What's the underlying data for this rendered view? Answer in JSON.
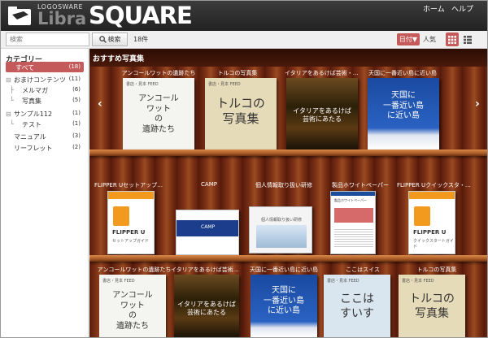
{
  "header": {
    "logo_small": "LOGOSWARE",
    "logo_libra": "Libra",
    "logo_square": "SQUARE",
    "nav": [
      "ホーム",
      "ヘルプ"
    ]
  },
  "search": {
    "placeholder": "検索",
    "button_label": "検索",
    "result_count": "18件"
  },
  "sort": {
    "selected": "日付▼",
    "alternate": "人気"
  },
  "sidebar": {
    "title": "カテゴリー",
    "items": [
      {
        "label": "すべて",
        "count": "(18)"
      },
      {
        "label": "おまけコンテンツ",
        "count": "(11)"
      },
      {
        "label": "メルマガ",
        "count": "(6)"
      },
      {
        "label": "写真集",
        "count": "(5)"
      },
      {
        "label": "サンプル112",
        "count": "(1)"
      },
      {
        "label": "テスト",
        "count": "(1)"
      },
      {
        "label": "マニュアル",
        "count": "(3)"
      },
      {
        "label": "リーフレット",
        "count": "(2)"
      }
    ]
  },
  "main": {
    "title": "おすすめ写真集",
    "shelf1": [
      {
        "title": "アンコールワットの遺跡たち",
        "cover_text": "アンコール\nワット\nの\n遺跡たち"
      },
      {
        "title": "トルコの写真集",
        "cover_text": "トルコの\n写真集"
      },
      {
        "title": "イタリアをあるけば芸術・・・",
        "cover_text": "イタリアをあるけば\n芸術にあたる"
      },
      {
        "title": "天国に一番近い島に近い島",
        "cover_text": "天国に\n一番近い島\nに近い島"
      }
    ],
    "shelf2": [
      {
        "title": "FLIPPER Uセットアップ・・・",
        "cover_brand": "FLIPPER U",
        "cover_sub": "セットアップガイド"
      },
      {
        "title": "CAMP",
        "cover_text": "CAMP"
      },
      {
        "title": "個人情報取り扱い研修",
        "cover_text": "個人情報取り扱い研修"
      },
      {
        "title": "製品ホワイトペーパー",
        "cover_text": "製品ホワイトペーパー"
      },
      {
        "title": "FLIPPER Uクイックスタ・・・",
        "cover_brand": "FLIPPER U",
        "cover_sub": "クイックスタートガイド"
      }
    ],
    "shelf3": [
      {
        "title": "アンコールワットの遺跡たち",
        "cover_text": "アンコール\nワット\nの\n遺跡たち"
      },
      {
        "title": "イタリアをあるけば芸術・・・",
        "cover_text": "イタリアをあるけば\n芸術にあたる"
      },
      {
        "title": "天国に一番近い島に近い島",
        "cover_text": "天国に\n一番近い島\nに近い島"
      },
      {
        "title": "ここはスイス",
        "cover_text": "ここは\nすいす"
      },
      {
        "title": "トルコの写真集",
        "cover_text": "トルコの\n写真集"
      }
    ],
    "cover_header": "書店・見本 FEED"
  },
  "colors": {
    "accent": "#c45a5a",
    "header_bg": "#2a2a2a",
    "flipper_orange": "#f29a1e"
  }
}
